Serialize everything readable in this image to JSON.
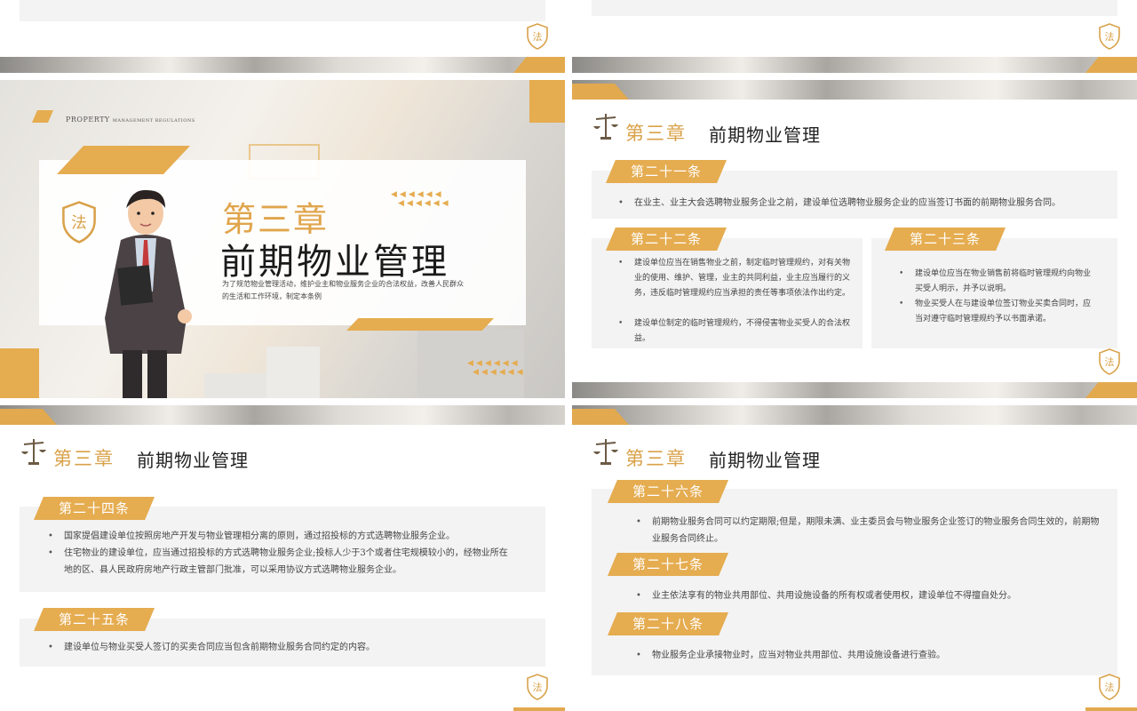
{
  "theme": {
    "accent": "#e5ac50",
    "panel": "#f3f3f3",
    "text": "#444444"
  },
  "chapter": "第三章",
  "title": "前期物业管理",
  "cover": {
    "kicker_main": "PROPERTY",
    "kicker_small": "MANAGEMENT REGULATIONS",
    "description": "为了规范物业管理活动，维护业主和物业服务企业的合法权益，改善人民群众的生活和工作环境，制定本条例",
    "seal_char": "法",
    "arrows": "◀◀◀◀◀◀"
  },
  "seal_char": "法",
  "slide2": {
    "article21": {
      "label": "第二十一条",
      "items": [
        "在业主、业主大会选聘物业服务企业之前，建设单位选聘物业服务企业的应当签订书面的前期物业服务合同。"
      ]
    },
    "article22": {
      "label": "第二十二条",
      "items": [
        "建设单位应当在销售物业之前，制定临时管理规约，对有关物业的使用、维护、管理，业主的共同利益，业主应当履行的义务，违反临时管理规约应当承担的责任等事项依法作出约定。",
        "建设单位制定的临时管理规约，不得侵害物业买受人的合法权益。"
      ]
    },
    "article23": {
      "label": "第二十三条",
      "items": [
        "建设单位应当在物业销售前将临时管理规约向物业买受人明示，并予以说明。",
        "物业买受人在与建设单位签订物业买卖合同时，应当对遵守临时管理规约予以书面承诺。"
      ]
    }
  },
  "slide3": {
    "article24": {
      "label": "第二十四条",
      "items": [
        "国家提倡建设单位按照房地产开发与物业管理相分离的原则，通过招投标的方式选聘物业服务企业。",
        "住宅物业的建设单位，应当通过招投标的方式选聘物业服务企业;投标人少于3个或者住宅规模较小的，经物业所在地的区、县人民政府房地产行政主管部门批准，可以采用协议方式选聘物业服务企业。"
      ]
    },
    "article25": {
      "label": "第二十五条",
      "items": [
        "建设单位与物业买受人签订的买卖合同应当包含前期物业服务合同约定的内容。"
      ]
    }
  },
  "slide4": {
    "article26": {
      "label": "第二十六条",
      "items": [
        "前期物业服务合同可以约定期限;但是，期限未满、业主委员会与物业服务企业签订的物业服务合同生效的，前期物业服务合同终止。"
      ]
    },
    "article27": {
      "label": "第二十七条",
      "items": [
        "业主依法享有的物业共用部位、共用设施设备的所有权或者使用权，建设单位不得擅自处分。"
      ]
    },
    "article28": {
      "label": "第二十八条",
      "items": [
        "物业服务企业承接物业时，应当对物业共用部位、共用设施设备进行查验。"
      ]
    }
  }
}
